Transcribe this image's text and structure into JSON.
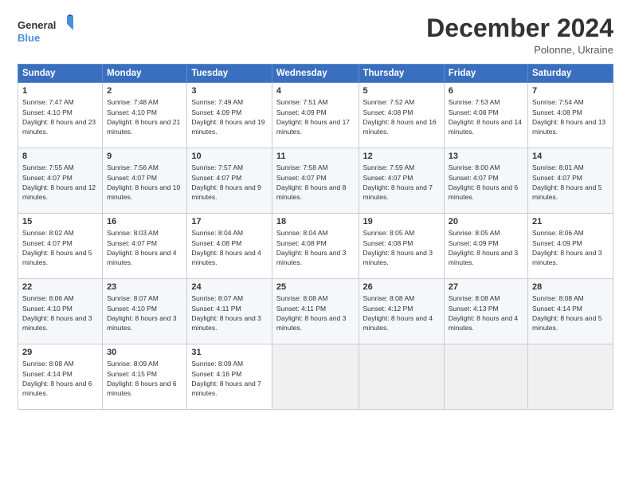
{
  "header": {
    "logo_general": "General",
    "logo_blue": "Blue",
    "month_title": "December 2024",
    "location": "Polonne, Ukraine"
  },
  "days_of_week": [
    "Sunday",
    "Monday",
    "Tuesday",
    "Wednesday",
    "Thursday",
    "Friday",
    "Saturday"
  ],
  "weeks": [
    [
      {
        "day": "1",
        "sunrise": "Sunrise: 7:47 AM",
        "sunset": "Sunset: 4:10 PM",
        "daylight": "Daylight: 8 hours and 23 minutes."
      },
      {
        "day": "2",
        "sunrise": "Sunrise: 7:48 AM",
        "sunset": "Sunset: 4:10 PM",
        "daylight": "Daylight: 8 hours and 21 minutes."
      },
      {
        "day": "3",
        "sunrise": "Sunrise: 7:49 AM",
        "sunset": "Sunset: 4:09 PM",
        "daylight": "Daylight: 8 hours and 19 minutes."
      },
      {
        "day": "4",
        "sunrise": "Sunrise: 7:51 AM",
        "sunset": "Sunset: 4:09 PM",
        "daylight": "Daylight: 8 hours and 17 minutes."
      },
      {
        "day": "5",
        "sunrise": "Sunrise: 7:52 AM",
        "sunset": "Sunset: 4:08 PM",
        "daylight": "Daylight: 8 hours and 16 minutes."
      },
      {
        "day": "6",
        "sunrise": "Sunrise: 7:53 AM",
        "sunset": "Sunset: 4:08 PM",
        "daylight": "Daylight: 8 hours and 14 minutes."
      },
      {
        "day": "7",
        "sunrise": "Sunrise: 7:54 AM",
        "sunset": "Sunset: 4:08 PM",
        "daylight": "Daylight: 8 hours and 13 minutes."
      }
    ],
    [
      {
        "day": "8",
        "sunrise": "Sunrise: 7:55 AM",
        "sunset": "Sunset: 4:07 PM",
        "daylight": "Daylight: 8 hours and 12 minutes."
      },
      {
        "day": "9",
        "sunrise": "Sunrise: 7:56 AM",
        "sunset": "Sunset: 4:07 PM",
        "daylight": "Daylight: 8 hours and 10 minutes."
      },
      {
        "day": "10",
        "sunrise": "Sunrise: 7:57 AM",
        "sunset": "Sunset: 4:07 PM",
        "daylight": "Daylight: 8 hours and 9 minutes."
      },
      {
        "day": "11",
        "sunrise": "Sunrise: 7:58 AM",
        "sunset": "Sunset: 4:07 PM",
        "daylight": "Daylight: 8 hours and 8 minutes."
      },
      {
        "day": "12",
        "sunrise": "Sunrise: 7:59 AM",
        "sunset": "Sunset: 4:07 PM",
        "daylight": "Daylight: 8 hours and 7 minutes."
      },
      {
        "day": "13",
        "sunrise": "Sunrise: 8:00 AM",
        "sunset": "Sunset: 4:07 PM",
        "daylight": "Daylight: 8 hours and 6 minutes."
      },
      {
        "day": "14",
        "sunrise": "Sunrise: 8:01 AM",
        "sunset": "Sunset: 4:07 PM",
        "daylight": "Daylight: 8 hours and 5 minutes."
      }
    ],
    [
      {
        "day": "15",
        "sunrise": "Sunrise: 8:02 AM",
        "sunset": "Sunset: 4:07 PM",
        "daylight": "Daylight: 8 hours and 5 minutes."
      },
      {
        "day": "16",
        "sunrise": "Sunrise: 8:03 AM",
        "sunset": "Sunset: 4:07 PM",
        "daylight": "Daylight: 8 hours and 4 minutes."
      },
      {
        "day": "17",
        "sunrise": "Sunrise: 8:04 AM",
        "sunset": "Sunset: 4:08 PM",
        "daylight": "Daylight: 8 hours and 4 minutes."
      },
      {
        "day": "18",
        "sunrise": "Sunrise: 8:04 AM",
        "sunset": "Sunset: 4:08 PM",
        "daylight": "Daylight: 8 hours and 3 minutes."
      },
      {
        "day": "19",
        "sunrise": "Sunrise: 8:05 AM",
        "sunset": "Sunset: 4:08 PM",
        "daylight": "Daylight: 8 hours and 3 minutes."
      },
      {
        "day": "20",
        "sunrise": "Sunrise: 8:05 AM",
        "sunset": "Sunset: 4:09 PM",
        "daylight": "Daylight: 8 hours and 3 minutes."
      },
      {
        "day": "21",
        "sunrise": "Sunrise: 8:06 AM",
        "sunset": "Sunset: 4:09 PM",
        "daylight": "Daylight: 8 hours and 3 minutes."
      }
    ],
    [
      {
        "day": "22",
        "sunrise": "Sunrise: 8:06 AM",
        "sunset": "Sunset: 4:10 PM",
        "daylight": "Daylight: 8 hours and 3 minutes."
      },
      {
        "day": "23",
        "sunrise": "Sunrise: 8:07 AM",
        "sunset": "Sunset: 4:10 PM",
        "daylight": "Daylight: 8 hours and 3 minutes."
      },
      {
        "day": "24",
        "sunrise": "Sunrise: 8:07 AM",
        "sunset": "Sunset: 4:11 PM",
        "daylight": "Daylight: 8 hours and 3 minutes."
      },
      {
        "day": "25",
        "sunrise": "Sunrise: 8:08 AM",
        "sunset": "Sunset: 4:11 PM",
        "daylight": "Daylight: 8 hours and 3 minutes."
      },
      {
        "day": "26",
        "sunrise": "Sunrise: 8:08 AM",
        "sunset": "Sunset: 4:12 PM",
        "daylight": "Daylight: 8 hours and 4 minutes."
      },
      {
        "day": "27",
        "sunrise": "Sunrise: 8:08 AM",
        "sunset": "Sunset: 4:13 PM",
        "daylight": "Daylight: 8 hours and 4 minutes."
      },
      {
        "day": "28",
        "sunrise": "Sunrise: 8:08 AM",
        "sunset": "Sunset: 4:14 PM",
        "daylight": "Daylight: 8 hours and 5 minutes."
      }
    ],
    [
      {
        "day": "29",
        "sunrise": "Sunrise: 8:08 AM",
        "sunset": "Sunset: 4:14 PM",
        "daylight": "Daylight: 8 hours and 6 minutes."
      },
      {
        "day": "30",
        "sunrise": "Sunrise: 8:09 AM",
        "sunset": "Sunset: 4:15 PM",
        "daylight": "Daylight: 8 hours and 6 minutes."
      },
      {
        "day": "31",
        "sunrise": "Sunrise: 8:09 AM",
        "sunset": "Sunset: 4:16 PM",
        "daylight": "Daylight: 8 hours and 7 minutes."
      },
      null,
      null,
      null,
      null
    ]
  ]
}
